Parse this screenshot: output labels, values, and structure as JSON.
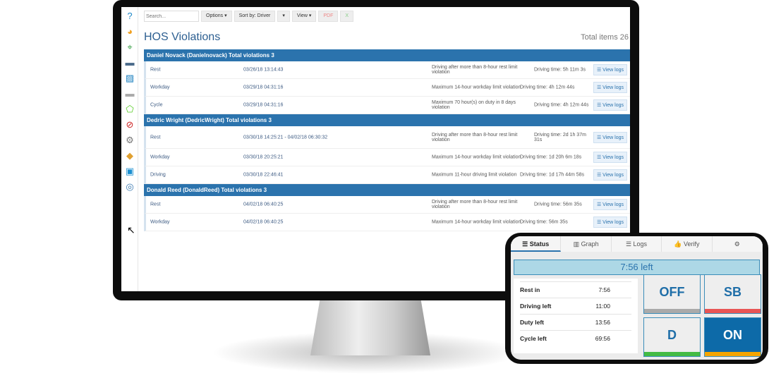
{
  "toolbar": {
    "search_placeholder": "Search...",
    "options": "Options ▾",
    "sort": "Sort by: Driver",
    "sort_drop": "▾",
    "view": "View ▾",
    "pdf": "PDF",
    "excel": "X"
  },
  "page": {
    "title": "HOS Violations",
    "total": "Total items 26"
  },
  "sidebar_icons": [
    "help-icon",
    "pie-chart-icon",
    "map-icon",
    "truck-icon",
    "activity-chart-icon",
    "engine-icon",
    "zone-icon",
    "block-icon",
    "gear-icon",
    "marketplace-icon",
    "user-card-icon",
    "support-icon"
  ],
  "groups": [
    {
      "header": "Daniel Novack (Danielnovack) Total violations 3",
      "rows": [
        {
          "type": "Rest",
          "date": "03/26/18 13:14:43",
          "desc": "Driving after more than 8-hour rest limit violation",
          "time": "Driving time: 5h 11m 3s"
        },
        {
          "type": "Workday",
          "date": "03/29/18 04:31:16",
          "desc": "Maximum 14-hour workday limit violation",
          "time": "Driving time: 4h 12m 44s"
        },
        {
          "type": "Cycle",
          "date": "03/29/18 04:31:16",
          "desc": "Maximum 70 hour(s) on duty in 8 days violation",
          "time": "Driving time: 4h 12m 44s"
        }
      ]
    },
    {
      "header": "Dedric Wright (DedricWright) Total violations 3",
      "rows": [
        {
          "type": "Rest",
          "date": "03/30/18 14:25:21 - 04/02/18 06:30:32",
          "desc": "Driving after more than 8-hour rest limit violation",
          "time": "Driving time: 2d 1h 37m 31s"
        },
        {
          "type": "Workday",
          "date": "03/30/18 20:25:21",
          "desc": "Maximum 14-hour workday limit violation",
          "time": "Driving time: 1d 20h 6m 18s"
        },
        {
          "type": "Driving",
          "date": "03/30/18 22:46:41",
          "desc": "Maximum 11-hour driving limit violation",
          "time": "Driving time: 1d 17h 44m 58s"
        }
      ]
    },
    {
      "header": "Donald Reed (DonaldReed) Total violations 3",
      "rows": [
        {
          "type": "Rest",
          "date": "04/02/18 06:40:25",
          "desc": "Driving after more than 8-hour rest limit violation",
          "time": "Driving time: 56m 35s"
        },
        {
          "type": "Workday",
          "date": "04/02/18 06:40:25",
          "desc": "Maximum 14-hour workday limit violation",
          "time": "Driving time: 56m 35s"
        }
      ]
    }
  ],
  "view_logs": "☰ View logs",
  "phone": {
    "tabs": [
      "☰ Status",
      "▥ Graph",
      "☰ Logs",
      "👍 Verify",
      "⚙"
    ],
    "time_left": "7:56 left",
    "stats": [
      {
        "label": "Rest in",
        "value": "7:56"
      },
      {
        "label": "Driving left",
        "value": "11:00"
      },
      {
        "label": "Duty left",
        "value": "13:56"
      },
      {
        "label": "Cycle left",
        "value": "69:56"
      }
    ],
    "buttons": [
      {
        "label": "OFF",
        "bar": "#aaaaaa"
      },
      {
        "label": "SB",
        "bar": "#e85555"
      },
      {
        "label": "D",
        "bar": "#44bb44"
      },
      {
        "label": "ON",
        "bar": "#f5a500",
        "active": true
      }
    ]
  }
}
